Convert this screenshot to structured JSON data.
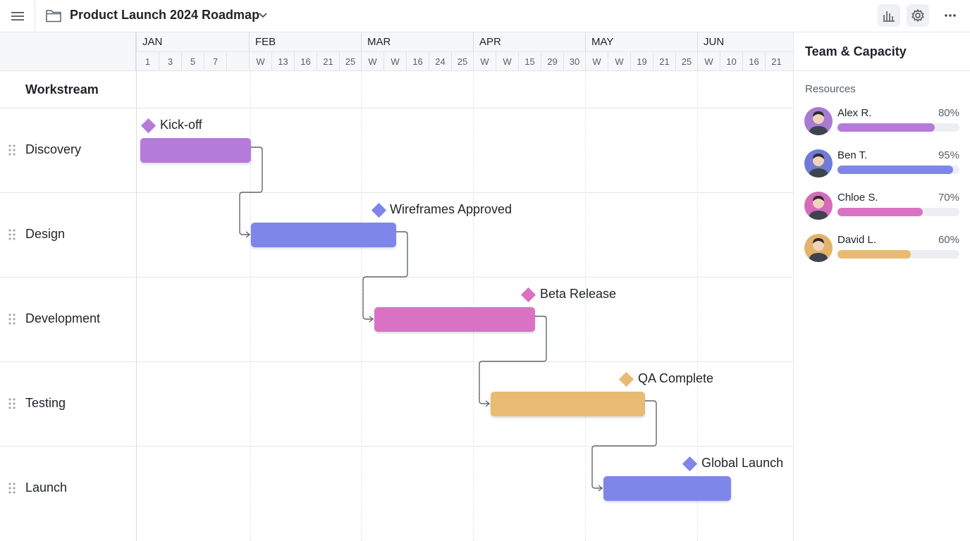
{
  "header": {
    "title": "Product Launch 2024 Roadmap",
    "icons": [
      "menu-icon",
      "folder-icon",
      "chevron-down-icon",
      "bar-chart-icon",
      "settings-icon",
      "more-icon"
    ]
  },
  "timeline": {
    "months": [
      "JAN",
      "FEB",
      "MAR",
      "APR",
      "MAY",
      "JUN"
    ],
    "days": [
      "1",
      "3",
      "5",
      "7",
      "",
      "W",
      "13",
      "16",
      "21",
      "25",
      "W",
      "W",
      "16",
      "24",
      "25",
      "W",
      "W",
      "15",
      "29",
      "30",
      "W",
      "W",
      "19",
      "21",
      "25",
      "W",
      "10",
      "16",
      "21"
    ]
  },
  "workstream": {
    "heading": "Workstream",
    "rows": [
      {
        "label": "Discovery",
        "milestone": "Kick-off",
        "color": "#b57bd9"
      },
      {
        "label": "Design",
        "milestone": "Wireframes Approved",
        "color": "#7f86ea"
      },
      {
        "label": "Development",
        "milestone": "Beta Release",
        "color": "#da72c3"
      },
      {
        "label": "Testing",
        "milestone": "QA Complete",
        "color": "#e8bb73"
      },
      {
        "label": "Launch",
        "milestone": "Global Launch",
        "color": "#7f86ea"
      }
    ]
  },
  "panel": {
    "title": "Team & Capacity",
    "resources_label": "Resources",
    "resources": [
      {
        "name": "Alex R.",
        "pct": "80%",
        "value": 0.8,
        "color": "#b57bd9",
        "avatar_bg": "#a77bcf"
      },
      {
        "name": "Ben T.",
        "pct": "95%",
        "value": 0.95,
        "color": "#7f86ea",
        "avatar_bg": "#6f7bd6"
      },
      {
        "name": "Chloe S.",
        "pct": "70%",
        "value": 0.7,
        "color": "#da72c3",
        "avatar_bg": "#d56bb9"
      },
      {
        "name": "David L.",
        "pct": "60%",
        "value": 0.6,
        "color": "#e8bb73",
        "avatar_bg": "#e3b36a"
      }
    ]
  }
}
